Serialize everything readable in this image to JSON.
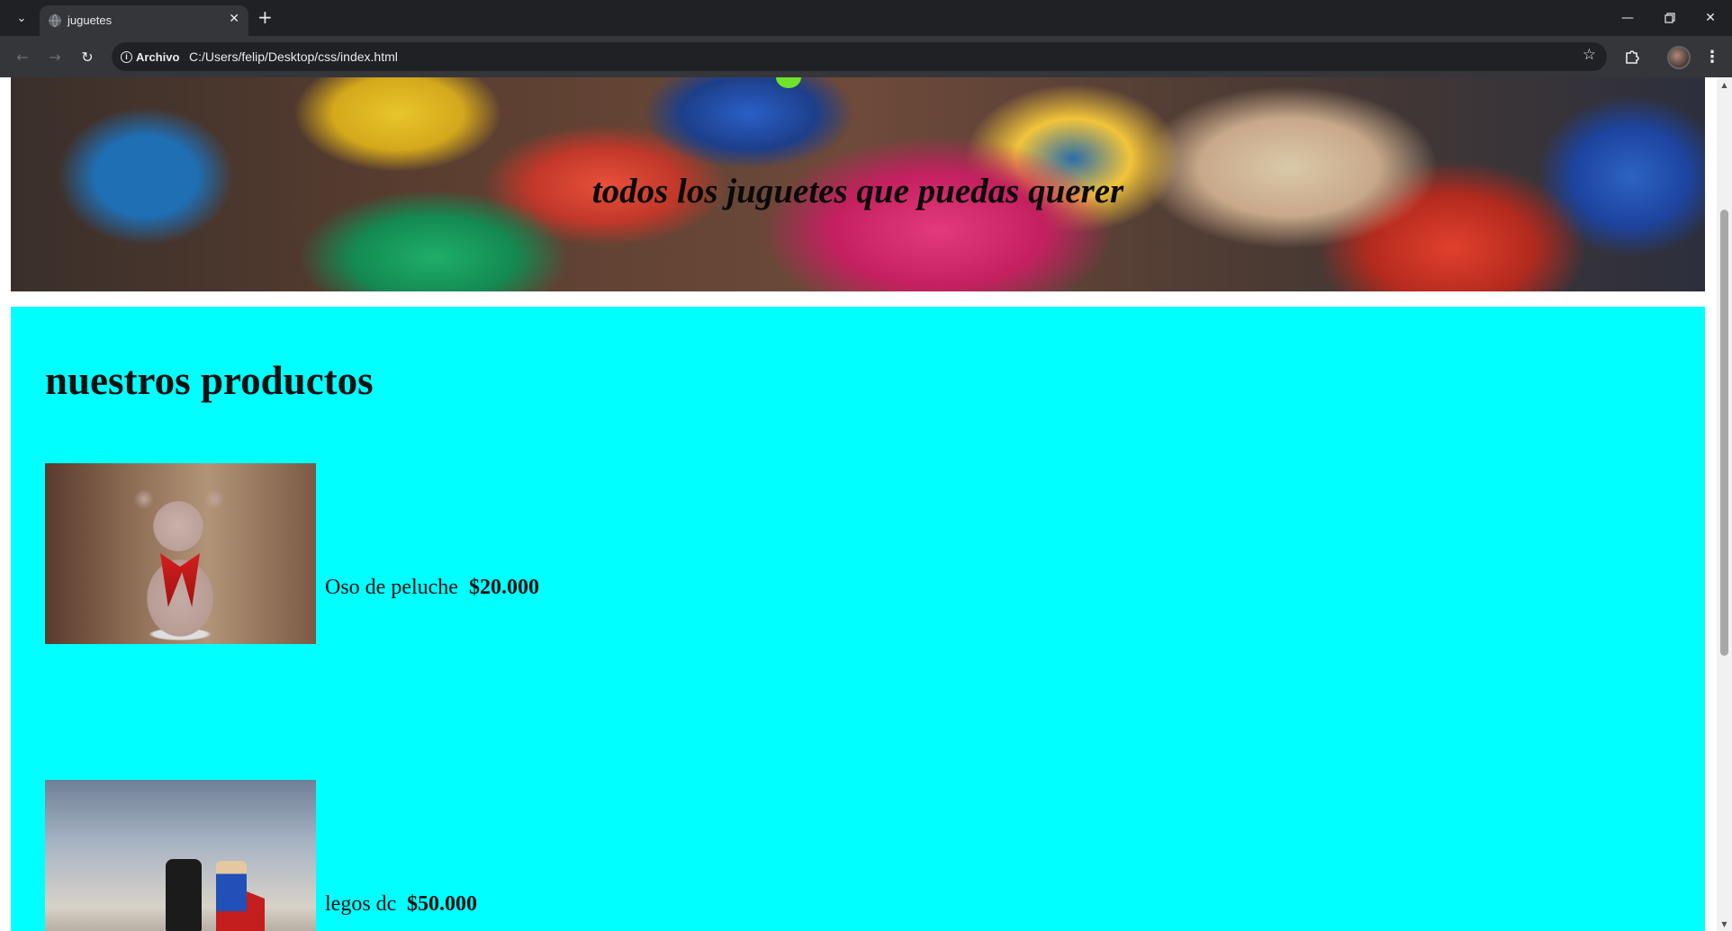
{
  "browser": {
    "tab_list_icon": "chevron-down-icon",
    "tab": {
      "title": "juguetes",
      "favicon": "globe-icon",
      "close_icon": "close-icon"
    },
    "new_tab_icon": "plus-icon",
    "window_controls": {
      "minimize": "minimize-icon",
      "restore": "restore-icon",
      "close": "close-icon"
    },
    "nav": {
      "back_icon": "arrow-left-icon",
      "forward_icon": "arrow-right-icon",
      "reload_icon": "reload-icon"
    },
    "omnibox": {
      "site_chip_label": "Archivo",
      "site_info_icon": "info-icon",
      "url": "C:/Users/felip/Desktop/css/index.html",
      "bookmark_icon": "star-icon"
    },
    "extensions_icon": "puzzle-icon",
    "profile_icon": "avatar",
    "menu_icon": "kebab-menu-icon"
  },
  "page": {
    "banner": {
      "tagline": "todos los juguetes que puedas querer"
    },
    "products_section": {
      "title": "nuestros productos",
      "background_color": "#00ffff",
      "items": [
        {
          "name": "Oso de peluche",
          "price": "$20.000",
          "image": "teddy-bear-photo"
        },
        {
          "name": "legos dc",
          "price": "$50.000",
          "image": "lego-batman-superman-photo"
        }
      ]
    }
  }
}
